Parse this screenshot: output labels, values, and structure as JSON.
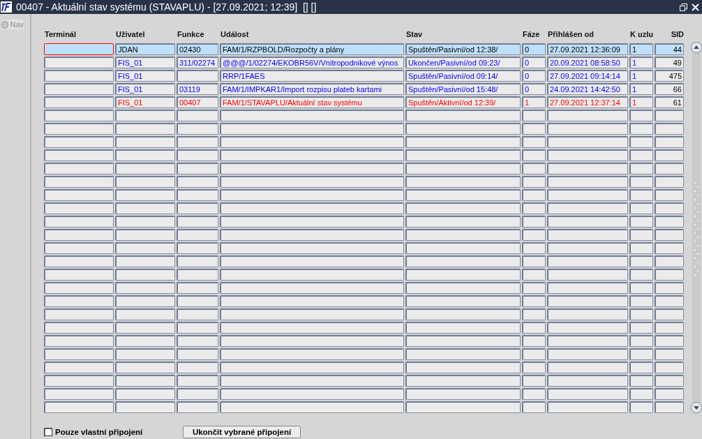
{
  "window": {
    "title": "00407 - Aktuální stav systému (STAVAPLU) - [27.09.2021; 12:39]  [] []"
  },
  "sidebar": {
    "nav_label": "Nav",
    "nav_selected": false
  },
  "table": {
    "columns": [
      "Terminál",
      "Uživatel",
      "Funkce",
      "Událost",
      "Stav",
      "Fáze",
      "Přihlášen od",
      "K uzlu",
      "SID"
    ],
    "rows": [
      {
        "selected": true,
        "color": "#000000",
        "cells": [
          "",
          "JDAN",
          "02430",
          "FAM/1/RZPBOLD/Rozpočty a plány",
          "Spuštěn/Pasivní/od 12:38/",
          "0",
          "27.09.2021 12:36:09",
          "1",
          "44"
        ]
      },
      {
        "selected": false,
        "color": "#0000ff",
        "cells": [
          "",
          "FIS_01",
          "311/02274",
          "@@@/1/02274/EKOBR56V/Vnitropodnikové výnos",
          "Ukončen/Pasivní/od 09:23/",
          "0",
          "20.09.2021 08:58:50",
          "1",
          "49"
        ]
      },
      {
        "selected": false,
        "color": "#0000ff",
        "cells": [
          "",
          "FIS_01",
          "",
          "RRP/1FAES",
          "Spuštěn/Pasivní/od 09:14/",
          "0",
          "27.09.2021 09:14:14",
          "1",
          "475"
        ]
      },
      {
        "selected": false,
        "color": "#0000ff",
        "cells": [
          "",
          "FIS_01",
          "03119",
          "FAM/1/IMPKAR1/Import rozpisu plateb kartami",
          "Spuštěn/Pasivní/od 15:48/",
          "0",
          "24.09.2021 14:42:50",
          "1",
          "66"
        ]
      },
      {
        "selected": false,
        "color": "#ff0000",
        "cells": [
          "",
          "FIS_01",
          "00407",
          "FAM/1/STAVAPLU/Aktuální stav systému",
          "Spuštěn/Aktivní/od 12:39/",
          "1",
          "27.09.2021 12:37:14",
          "1",
          "61"
        ]
      }
    ]
  },
  "footer": {
    "checkbox": {
      "label": "Pouze vlastní připojení",
      "checked": false
    },
    "button": "Ukončit vybrané připojení"
  }
}
